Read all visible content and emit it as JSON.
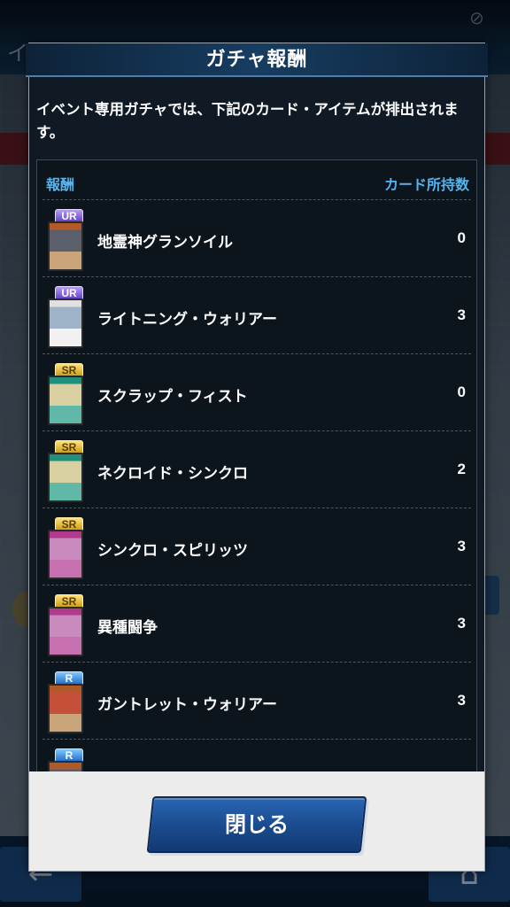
{
  "background": {
    "title_partial": "イベ",
    "statusbar": "",
    "back_icon": "arrow-left-icon",
    "home_icon": "home-icon"
  },
  "modal": {
    "title": "ガチャ報酬",
    "description": "イベント専用ガチャでは、下記のカード・アイテムが排出されます。",
    "columns": {
      "reward": "報酬",
      "owned": "カード所持数"
    },
    "rows": [
      {
        "rarity": "UR",
        "name": "地霊神グランソイル",
        "count": "0",
        "card_icon": "effect-monster-card-icon"
      },
      {
        "rarity": "UR",
        "name": "ライトニング・ウォリアー",
        "count": "3",
        "card_icon": "synchro-monster-card-icon"
      },
      {
        "rarity": "SR",
        "name": "スクラップ・フィスト",
        "count": "0",
        "card_icon": "spell-card-icon"
      },
      {
        "rarity": "SR",
        "name": "ネクロイド・シンクロ",
        "count": "2",
        "card_icon": "spell-card-icon"
      },
      {
        "rarity": "SR",
        "name": "シンクロ・スピリッツ",
        "count": "3",
        "card_icon": "trap-card-icon"
      },
      {
        "rarity": "SR",
        "name": "異種闘争",
        "count": "3",
        "card_icon": "trap-card-icon"
      },
      {
        "rarity": "R",
        "name": "ガントレット・ウォリアー",
        "count": "3",
        "card_icon": "effect-monster-card-icon"
      },
      {
        "rarity": "R",
        "name": "",
        "count": "",
        "card_icon": "effect-monster-card-icon"
      }
    ],
    "close_label": "閉じる"
  }
}
